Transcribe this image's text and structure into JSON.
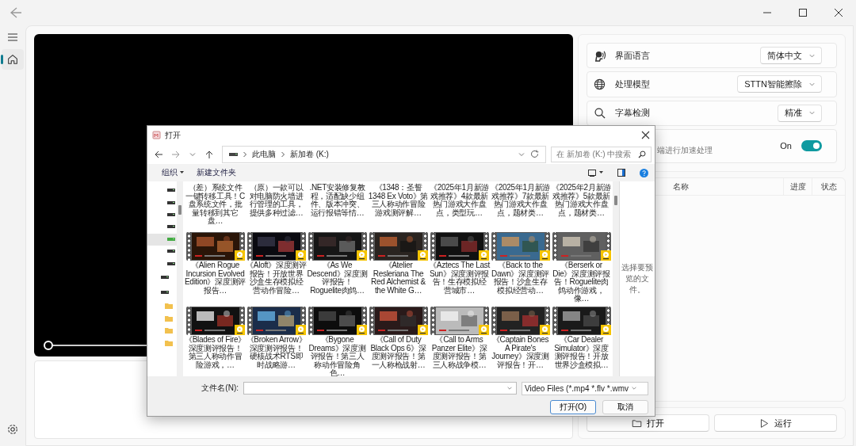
{
  "sidebar": {
    "items": [
      {
        "kind": "home",
        "selected": true
      },
      {
        "kind": "settings",
        "selected": false
      }
    ]
  },
  "player": {
    "level": 0
  },
  "settings": [
    {
      "kind": "select",
      "label": "界面语言",
      "value": "简体中文"
    },
    {
      "kind": "select",
      "label": "处理模型",
      "value": "STTN智能擦除"
    },
    {
      "kind": "select",
      "label": "字幕检测",
      "value": "精准"
    },
    {
      "kind": "toggle",
      "description": "端进行加速处理",
      "state_text": "On",
      "on": true
    }
  ],
  "task_table": {
    "columns": [
      "名称",
      "进度",
      "状态"
    ]
  },
  "actions": [
    {
      "kind": "open",
      "label": "打开"
    },
    {
      "kind": "run",
      "label": "运行"
    }
  ],
  "dialog": {
    "title": "打开",
    "breadcrumb": [
      "此电脑",
      "新加卷 (K:)"
    ],
    "search": {
      "placeholder": "在 新加卷 (K:) 中搜索"
    },
    "toolbar": [
      {
        "label": "组织",
        "menu": true
      },
      {
        "label": "新建文件夹",
        "menu": false
      }
    ],
    "nav_pane": [
      {
        "kind": "volume",
        "selected": false
      },
      {
        "kind": "volume",
        "selected": false
      },
      {
        "kind": "volume",
        "selected": false
      },
      {
        "kind": "volume",
        "selected": false
      },
      {
        "kind": "volume",
        "selected": true
      },
      {
        "kind": "volume",
        "selected": false
      },
      {
        "kind": "volume",
        "selected": false
      },
      {
        "kind": "drive",
        "selected": false
      },
      {
        "kind": "drive",
        "selected": false
      },
      {
        "kind": "folder",
        "selected": false
      },
      {
        "kind": "folder",
        "selected": false
      },
      {
        "kind": "folder",
        "selected": false
      },
      {
        "kind": "folder",
        "selected": false
      }
    ],
    "files": [
      {
        "kind": "caption_only",
        "name": "（差）系统文件一键转移工具！C盘系统文件，批量转移到其它盘…"
      },
      {
        "kind": "caption_only",
        "name": "（原）一款可以对电脑防火墙进行管理的工具，提供多种过滤…"
      },
      {
        "kind": "caption_only",
        "name": ".NET安装修复教程，适配缺少组件、版本冲突、运行报错等情…"
      },
      {
        "kind": "caption_only",
        "name": "《1348：圣誓1348 Ex Voto》第三人称动作冒险游戏测评解…"
      },
      {
        "kind": "caption_only",
        "name": "《2025年1月新游戏推荐》4款最新热门游戏大作盘点，类型玩…"
      },
      {
        "kind": "caption_only",
        "name": "《2025年1月新游戏推荐》7款最新热门游戏大作盘点，题材类…"
      },
      {
        "kind": "caption_only",
        "name": "《2025年2月新游戏推荐》5款最新热门游戏大作盘点，题材类…"
      },
      {
        "kind": "video",
        "name": "《Alien Rogue Incursion Evolved Edition》深度测评报告…"
      },
      {
        "kind": "video",
        "name": "《Aloft》深度测评报告！开放世界沙盒生存模拟经营动作冒险…"
      },
      {
        "kind": "video",
        "name": "《As We Descend》深度测评报告！Roguelite肉鸽…"
      },
      {
        "kind": "video",
        "name": "《Atelier Resleriana The Red Alchemist & the White G…"
      },
      {
        "kind": "video",
        "name": "《Aztecs The Last Sun》深度测评报告！生存模拟经营城市…"
      },
      {
        "kind": "video",
        "name": "《Back to the Dawn》深度测评报告！沙盒生存模拟经营动…"
      },
      {
        "kind": "video",
        "name": "《Berserk or Die》深度测评报告！Roguelite肉鸽动作游戏，像…"
      },
      {
        "kind": "video",
        "name": "《Blades of Fire》深度测评报告！第三人称动作冒险游戏，…"
      },
      {
        "kind": "video",
        "name": "《Broken Arrow》深度测评报告！硬核战术RTS即时战略游…"
      },
      {
        "kind": "video",
        "name": "《Bygone Dreams》深度测评报告！第三人称动作冒险角色…"
      },
      {
        "kind": "video",
        "name": "《Call of Duty Black Ops 6》深度测评报告！第一人称枪战射…"
      },
      {
        "kind": "video",
        "name": "《Call to Arms Panzer Elite》深度测评报告！第三人称战争模…"
      },
      {
        "kind": "video",
        "name": "《Captain Bones A Pirate's Journey》深度测评报告！开…"
      },
      {
        "kind": "video",
        "name": "《Car Dealer Simulator》深度测评报告！开放世界沙盒模拟…"
      }
    ],
    "preview_hint": "选择要预览的文件。",
    "filename_label": "文件名(N):",
    "file_type": "Video Files (*.mp4 *.flv *.wmv",
    "buttons": [
      {
        "label": "打开(O)",
        "default": true
      },
      {
        "label": "取消",
        "default": false
      }
    ]
  }
}
